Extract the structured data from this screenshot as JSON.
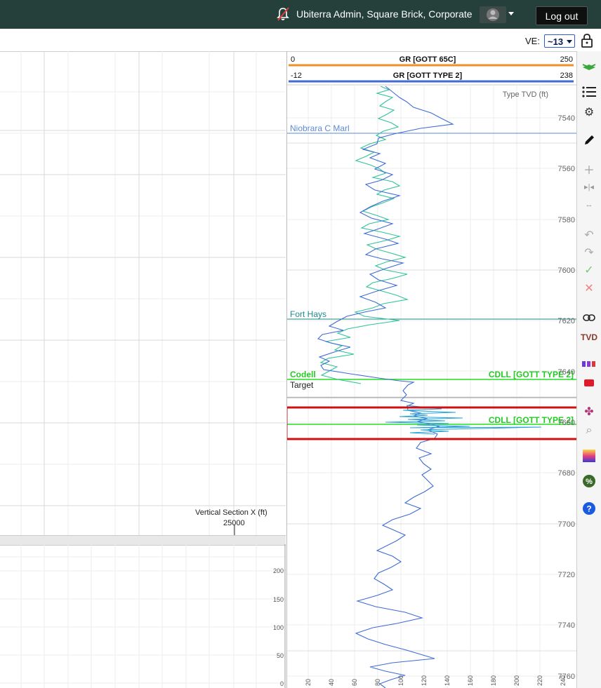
{
  "header": {
    "user_text": "Ubiterra Admin, Square Brick, Corporate",
    "logout_label": "Log out",
    "bell_icon": "bell-off-icon",
    "avatar_icon": "user-avatar-icon"
  },
  "toolbar_top": {
    "ve_label": "VE:",
    "ve_value": "~13"
  },
  "cross_section": {
    "axis_label": "Vertical Section X (ft)",
    "axis_value": "25000",
    "lower_y_ticks": [
      "200",
      "150",
      "100",
      "50",
      "0"
    ]
  },
  "log_track": {
    "curve1": {
      "name": "GR [GOTT 65C]",
      "min": "0",
      "max": "250",
      "color": "#f0902a"
    },
    "curve2": {
      "name": "GR [GOTT TYPE 2]",
      "min": "-12",
      "max": "238",
      "color": "#3f6bd6"
    },
    "depth_axis_label": "Type TVD (ft)",
    "depth_ticks": [
      "7540",
      "7560",
      "7580",
      "7600",
      "7620",
      "7640",
      "7660",
      "7680",
      "7700",
      "7720",
      "7740",
      "7760"
    ],
    "bottom_ticks": [
      "20",
      "40",
      "60",
      "80",
      "100",
      "120",
      "140",
      "160",
      "180",
      "200",
      "220",
      "240"
    ],
    "tops": [
      {
        "name": "Niobrara C Marl",
        "color": "#5a8ad6"
      },
      {
        "name": "Fort Hays",
        "color": "#1f8a8a"
      },
      {
        "name": "Codell",
        "color": "#22cc22"
      },
      {
        "name": "Target",
        "color": "#222222"
      }
    ],
    "cdll_labels": [
      "CDLL [GOTT TYPE 2]",
      "CDLL [GOTT TYPE 2]"
    ]
  },
  "colors": {
    "topbar_bg": "#25403a",
    "highlight": "#d01010",
    "green_line": "#22dd22"
  },
  "side_tools": [
    "layers-icon",
    "list-icon",
    "gear-icon",
    "pencil-icon",
    "plus-icon",
    "split-icon",
    "width-icon",
    "undo-icon",
    "redo-icon",
    "check-icon",
    "cancel-icon",
    "link-icon",
    "tvd-icon",
    "bars-icon",
    "red-block-icon",
    "color-picker-icon",
    "zoom-icon",
    "gradient-icon",
    "percent-icon",
    "help-icon"
  ],
  "tvd_label": "TVD"
}
